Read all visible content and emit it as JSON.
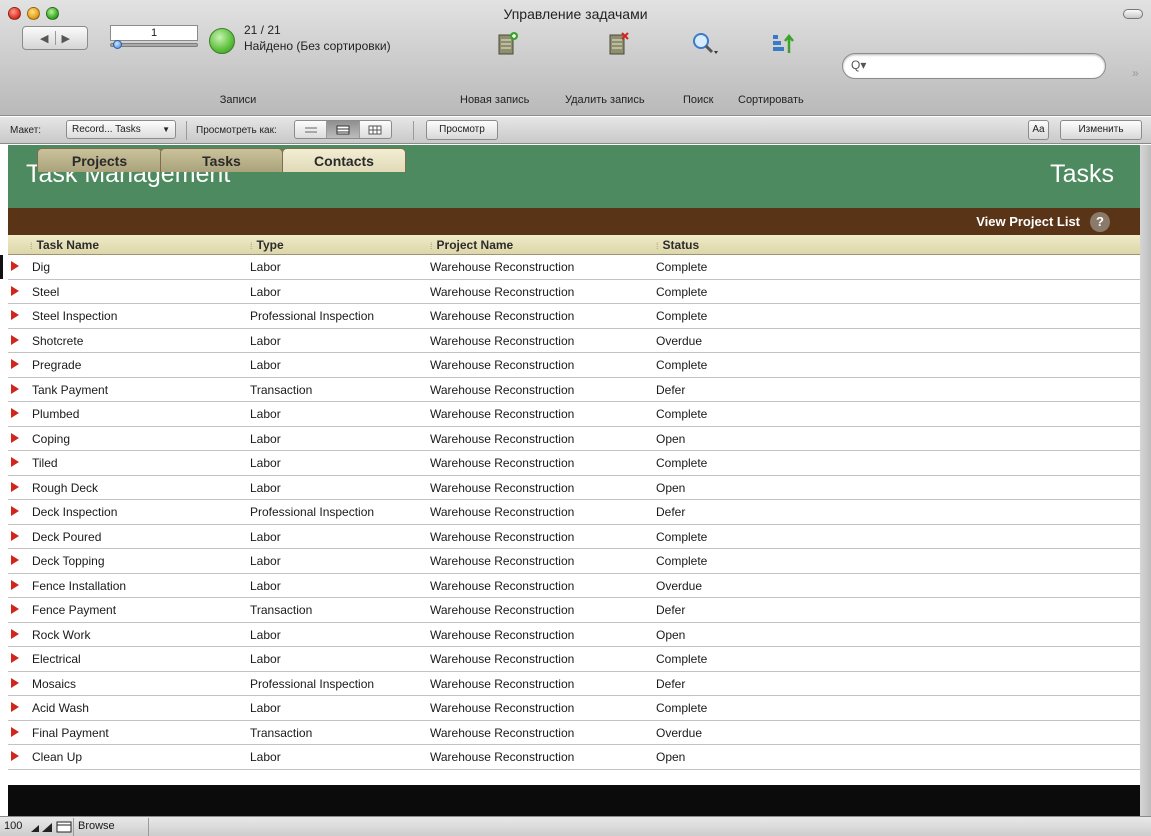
{
  "window": {
    "title": "Управление задачами"
  },
  "toolbar": {
    "record_number": "1",
    "found_count": "21 / 21",
    "found_text": "Найдено (Без сортировки)",
    "records_label": "Записи",
    "new_record": "Новая запись",
    "delete_record": "Удалить запись",
    "find": "Поиск",
    "sort": "Сортировать",
    "search_placeholder": ""
  },
  "layout_bar": {
    "layout_label": "Макет:",
    "layout_value": "Record... Tasks",
    "view_as_label": "Просмотреть как:",
    "preview_button": "Просмотр",
    "font_button": "Aa",
    "edit_button": "Изменить"
  },
  "header": {
    "title": "Task Management",
    "section": "Tasks"
  },
  "tabs": [
    {
      "label": "Projects",
      "active": false
    },
    {
      "label": "Tasks",
      "active": false
    },
    {
      "label": "Contacts",
      "active": true
    }
  ],
  "view_project_list": "View Project List",
  "help_label": "?",
  "columns": [
    "Task Name",
    "Type",
    "Project Name",
    "Status"
  ],
  "rows": [
    {
      "name": "Dig",
      "type": "Labor",
      "project": "Warehouse Reconstruction",
      "status": "Complete"
    },
    {
      "name": "Steel",
      "type": "Labor",
      "project": "Warehouse Reconstruction",
      "status": "Complete"
    },
    {
      "name": "Steel Inspection",
      "type": "Professional Inspection",
      "project": "Warehouse Reconstruction",
      "status": "Complete"
    },
    {
      "name": "Shotcrete",
      "type": "Labor",
      "project": "Warehouse Reconstruction",
      "status": "Overdue"
    },
    {
      "name": "Pregrade",
      "type": "Labor",
      "project": "Warehouse Reconstruction",
      "status": "Complete"
    },
    {
      "name": "Tank Payment",
      "type": "Transaction",
      "project": "Warehouse Reconstruction",
      "status": "Defer"
    },
    {
      "name": "Plumbed",
      "type": "Labor",
      "project": "Warehouse Reconstruction",
      "status": "Complete"
    },
    {
      "name": "Coping",
      "type": "Labor",
      "project": "Warehouse Reconstruction",
      "status": "Open"
    },
    {
      "name": "Tiled",
      "type": "Labor",
      "project": "Warehouse Reconstruction",
      "status": "Complete"
    },
    {
      "name": "Rough Deck",
      "type": "Labor",
      "project": "Warehouse Reconstruction",
      "status": "Open"
    },
    {
      "name": "Deck Inspection",
      "type": "Professional Inspection",
      "project": "Warehouse Reconstruction",
      "status": "Defer"
    },
    {
      "name": "Deck Poured",
      "type": "Labor",
      "project": "Warehouse Reconstruction",
      "status": "Complete"
    },
    {
      "name": "Deck Topping",
      "type": "Labor",
      "project": "Warehouse Reconstruction",
      "status": "Complete"
    },
    {
      "name": "Fence Installation",
      "type": "Labor",
      "project": "Warehouse Reconstruction",
      "status": "Overdue"
    },
    {
      "name": "Fence Payment",
      "type": "Transaction",
      "project": "Warehouse Reconstruction",
      "status": "Defer"
    },
    {
      "name": "Rock Work",
      "type": "Labor",
      "project": "Warehouse Reconstruction",
      "status": "Open"
    },
    {
      "name": "Electrical",
      "type": "Labor",
      "project": "Warehouse Reconstruction",
      "status": "Complete"
    },
    {
      "name": "Mosaics",
      "type": "Professional Inspection",
      "project": "Warehouse Reconstruction",
      "status": "Defer"
    },
    {
      "name": "Acid Wash",
      "type": "Labor",
      "project": "Warehouse Reconstruction",
      "status": "Complete"
    },
    {
      "name": "Final Payment",
      "type": "Transaction",
      "project": "Warehouse Reconstruction",
      "status": "Overdue"
    },
    {
      "name": "Clean Up",
      "type": "Labor",
      "project": "Warehouse Reconstruction",
      "status": "Open"
    }
  ],
  "statusbar": {
    "zoom": "100",
    "mode": "Browse"
  },
  "colors": {
    "header_green": "#4e8a5f",
    "tab_strip_brown": "#5a3417",
    "row_arrow_red": "#d0261c"
  }
}
